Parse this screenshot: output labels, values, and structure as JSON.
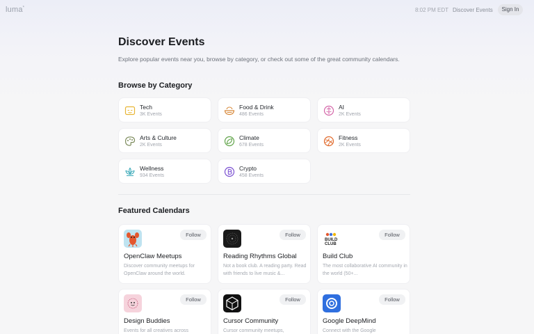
{
  "header": {
    "logo": "luma",
    "logo_mark": "*",
    "time": "8:02 PM EDT",
    "discover_link": "Discover Events",
    "sign_in": "Sign In"
  },
  "page": {
    "title": "Discover Events",
    "subtitle": "Explore popular events near you, browse by category, or check out some of the great community calendars."
  },
  "categories": {
    "heading": "Browse by Category",
    "items": [
      {
        "name": "Tech",
        "count": "3K Events",
        "icon": "tech-icon",
        "color": "#e8b534"
      },
      {
        "name": "Food & Drink",
        "count": "486 Events",
        "icon": "food-bowl-icon",
        "color": "#d8893a"
      },
      {
        "name": "AI",
        "count": "2K Events",
        "icon": "ai-brain-icon",
        "color": "#d466a8"
      },
      {
        "name": "Arts & Culture",
        "count": "2K Events",
        "icon": "palette-icon",
        "color": "#7b8a5a"
      },
      {
        "name": "Climate",
        "count": "678 Events",
        "icon": "leaf-globe-icon",
        "color": "#5fa348"
      },
      {
        "name": "Fitness",
        "count": "2K Events",
        "icon": "runner-icon",
        "color": "#e06a2c"
      },
      {
        "name": "Wellness",
        "count": "934 Events",
        "icon": "lotus-icon",
        "color": "#3aa9b8"
      },
      {
        "name": "Crypto",
        "count": "458 Events",
        "icon": "bitcoin-icon",
        "color": "#7a4fd1"
      }
    ]
  },
  "calendars": {
    "heading": "Featured Calendars",
    "follow_label": "Follow",
    "items": [
      {
        "name": "OpenClaw Meetups",
        "desc": "Discover community meetups for OpenClaw around the world.",
        "avatar": "lobster-avatar-icon"
      },
      {
        "name": "Reading Rhythms Global",
        "desc": "Not a book club. A reading party. Read with friends to live music &...",
        "avatar": "reading-rhythms-avatar-icon"
      },
      {
        "name": "Build Club",
        "desc": "The most collaborative AI community in the world (50+...",
        "avatar": "build-club-avatar-icon",
        "avatar_text": "BUILD\nCLUB"
      },
      {
        "name": "Design Buddies",
        "desc": "Events for all creatives across",
        "avatar": "design-buddies-avatar-icon"
      },
      {
        "name": "Cursor Community",
        "desc": "Cursor community meetups,",
        "avatar": "cursor-cube-avatar-icon"
      },
      {
        "name": "Google DeepMind",
        "desc": "Connect with the Google",
        "avatar": "deepmind-avatar-icon"
      }
    ]
  }
}
